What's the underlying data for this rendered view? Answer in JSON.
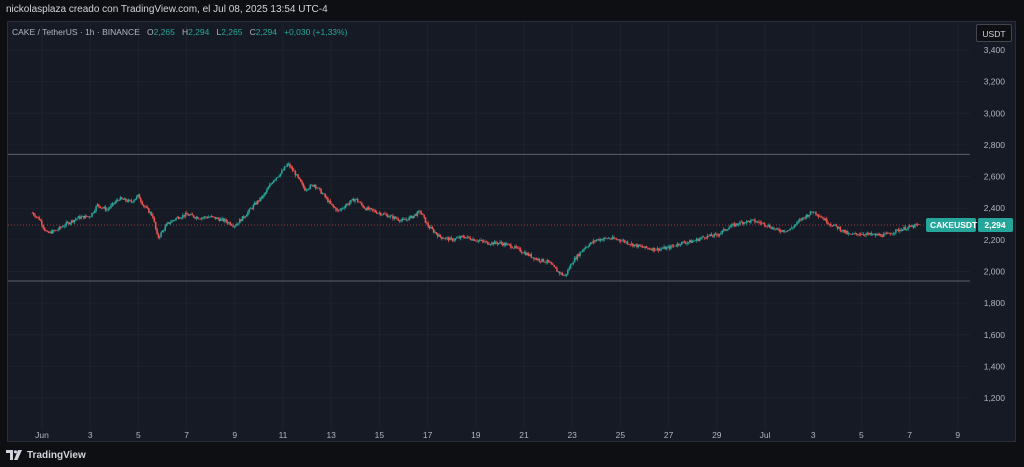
{
  "header": {
    "caption": "nickolasplaza creado con TradingView.com, el Jul 08, 2025 13:54 UTC-4"
  },
  "legend": {
    "symbol": "CAKE / TetherUS · 1h · BINANCE",
    "o_label": "O",
    "o_value": "2,265",
    "h_label": "H",
    "h_value": "2,294",
    "l_label": "L",
    "l_value": "2,265",
    "c_label": "C",
    "c_value": "2,294",
    "change": "+0,030 (+1,33%)"
  },
  "price_scale": {
    "unit_label": "USDT"
  },
  "price_tag": {
    "symbol": "CAKEUSDT",
    "value": "2,294"
  },
  "footer": {
    "brand": "TradingView"
  },
  "colors": {
    "up": "#26a69a",
    "down": "#ef5350",
    "background": "#161a25",
    "grid": "#1e222d",
    "accent": "#26a69a"
  },
  "chart_data": {
    "type": "candlestick",
    "symbol": "CAKE / TetherUS",
    "interval": "1h",
    "exchange": "BINANCE",
    "ylim": [
      1100,
      3500
    ],
    "y_ticks": [
      "3,400",
      "3,200",
      "3,000",
      "2,800",
      "2,600",
      "2,400",
      "2,200",
      "2,000",
      "1,800",
      "1,600",
      "1,400",
      "1,200"
    ],
    "y_tick_values": [
      3400,
      3200,
      3000,
      2800,
      2600,
      2400,
      2200,
      2000,
      1800,
      1600,
      1400,
      1200
    ],
    "x_ticks": [
      "Jun",
      "3",
      "5",
      "7",
      "9",
      "11",
      "13",
      "15",
      "17",
      "19",
      "21",
      "23",
      "25",
      "27",
      "29",
      "Jul",
      "3",
      "5",
      "7",
      "9"
    ],
    "x_tick_days": [
      1,
      3,
      5,
      7,
      9,
      11,
      13,
      15,
      17,
      19,
      21,
      23,
      25,
      27,
      29,
      31,
      33,
      35,
      37,
      39
    ],
    "xlim_days": [
      0.6,
      40.0
    ],
    "horizontal_lines": [
      2740,
      1940,
      2294
    ],
    "last_price": 2294,
    "path": [
      [
        0.6,
        2370
      ],
      [
        0.9,
        2330
      ],
      [
        1.2,
        2240
      ],
      [
        1.6,
        2260
      ],
      [
        2.0,
        2300
      ],
      [
        2.5,
        2340
      ],
      [
        3.0,
        2350
      ],
      [
        3.3,
        2420
      ],
      [
        3.7,
        2390
      ],
      [
        4.2,
        2460
      ],
      [
        4.7,
        2440
      ],
      [
        5.0,
        2480
      ],
      [
        5.2,
        2420
      ],
      [
        5.6,
        2350
      ],
      [
        5.8,
        2210
      ],
      [
        6.2,
        2300
      ],
      [
        6.6,
        2340
      ],
      [
        7.0,
        2360
      ],
      [
        7.5,
        2340
      ],
      [
        8.0,
        2345
      ],
      [
        8.6,
        2320
      ],
      [
        9.0,
        2290
      ],
      [
        9.4,
        2350
      ],
      [
        9.8,
        2420
      ],
      [
        10.2,
        2480
      ],
      [
        10.6,
        2580
      ],
      [
        10.9,
        2620
      ],
      [
        11.2,
        2680
      ],
      [
        11.5,
        2620
      ],
      [
        11.9,
        2520
      ],
      [
        12.3,
        2550
      ],
      [
        12.7,
        2480
      ],
      [
        13.0,
        2420
      ],
      [
        13.3,
        2380
      ],
      [
        13.6,
        2420
      ],
      [
        14.0,
        2460
      ],
      [
        14.4,
        2400
      ],
      [
        14.8,
        2380
      ],
      [
        15.2,
        2360
      ],
      [
        15.6,
        2340
      ],
      [
        16.0,
        2320
      ],
      [
        16.4,
        2350
      ],
      [
        16.7,
        2380
      ],
      [
        17.0,
        2290
      ],
      [
        17.5,
        2220
      ],
      [
        18.0,
        2200
      ],
      [
        18.5,
        2220
      ],
      [
        19.0,
        2200
      ],
      [
        19.5,
        2180
      ],
      [
        20.0,
        2180
      ],
      [
        20.5,
        2160
      ],
      [
        21.0,
        2120
      ],
      [
        21.5,
        2080
      ],
      [
        22.0,
        2060
      ],
      [
        22.4,
        2000
      ],
      [
        22.7,
        1970
      ],
      [
        23.0,
        2060
      ],
      [
        23.5,
        2150
      ],
      [
        24.0,
        2200
      ],
      [
        24.5,
        2210
      ],
      [
        25.0,
        2200
      ],
      [
        25.5,
        2170
      ],
      [
        26.0,
        2150
      ],
      [
        26.5,
        2140
      ],
      [
        27.0,
        2150
      ],
      [
        27.5,
        2180
      ],
      [
        28.0,
        2190
      ],
      [
        28.5,
        2220
      ],
      [
        29.0,
        2230
      ],
      [
        29.5,
        2280
      ],
      [
        30.0,
        2310
      ],
      [
        30.5,
        2320
      ],
      [
        31.0,
        2300
      ],
      [
        31.5,
        2260
      ],
      [
        32.0,
        2260
      ],
      [
        32.5,
        2330
      ],
      [
        33.0,
        2380
      ],
      [
        33.3,
        2350
      ],
      [
        33.7,
        2300
      ],
      [
        34.0,
        2280
      ],
      [
        34.5,
        2230
      ],
      [
        35.0,
        2240
      ],
      [
        35.5,
        2230
      ],
      [
        36.0,
        2230
      ],
      [
        36.5,
        2260
      ],
      [
        37.0,
        2280
      ],
      [
        37.4,
        2294
      ]
    ]
  }
}
